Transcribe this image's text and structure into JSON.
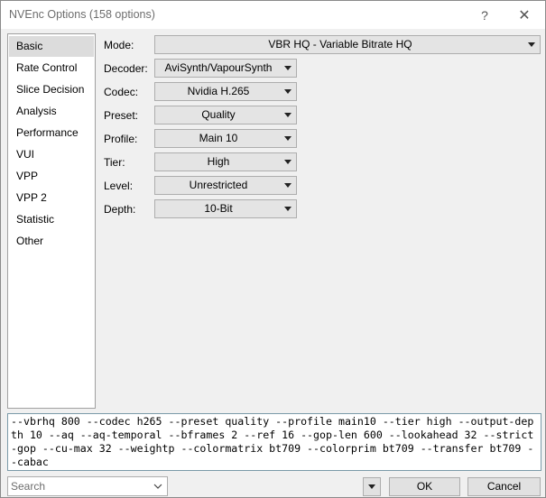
{
  "window": {
    "title": "NVEnc Options (158 options)",
    "help_glyph": "?",
    "close_glyph": "✕"
  },
  "sidebar": {
    "items": [
      {
        "label": "Basic",
        "selected": true
      },
      {
        "label": "Rate Control"
      },
      {
        "label": "Slice Decision"
      },
      {
        "label": "Analysis"
      },
      {
        "label": "Performance"
      },
      {
        "label": "VUI"
      },
      {
        "label": "VPP"
      },
      {
        "label": "VPP 2"
      },
      {
        "label": "Statistic"
      },
      {
        "label": "Other"
      }
    ]
  },
  "options": {
    "mode": {
      "label": "Mode:",
      "value": "VBR HQ - Variable Bitrate HQ"
    },
    "decoder": {
      "label": "Decoder:",
      "value": "AviSynth/VapourSynth"
    },
    "codec": {
      "label": "Codec:",
      "value": "Nvidia H.265"
    },
    "preset": {
      "label": "Preset:",
      "value": "Quality"
    },
    "profile": {
      "label": "Profile:",
      "value": "Main 10"
    },
    "tier": {
      "label": "Tier:",
      "value": "High"
    },
    "level": {
      "label": "Level:",
      "value": "Unrestricted"
    },
    "depth": {
      "label": "Depth:",
      "value": "10-Bit"
    }
  },
  "command_line": "--vbrhq 800 --codec h265 --preset quality --profile main10 --tier high --output-depth 10 --aq --aq-temporal --bframes 2 --ref 16 --gop-len 600 --lookahead 32 --strict-gop --cu-max 32 --weightp --colormatrix bt709 --colorprim bt709 --transfer bt709 --cabac",
  "footer": {
    "search_placeholder": "Search",
    "ok_label": "OK",
    "cancel_label": "Cancel"
  },
  "icons": {
    "help": "help-icon",
    "close": "close-icon",
    "dropdown": "chevron-down-icon"
  }
}
